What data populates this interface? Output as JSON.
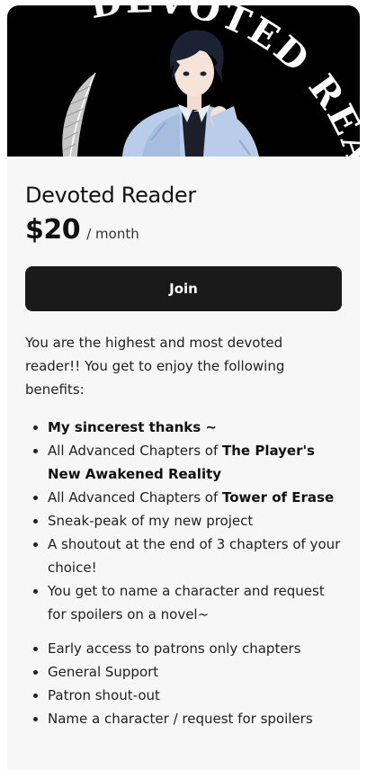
{
  "banner": {
    "arc_text": "DEVOTED READER"
  },
  "tier": {
    "title": "Devoted Reader",
    "price": "$20",
    "period": "/ month",
    "join_label": "Join",
    "description": "You are the highest and most devoted reader!! You get to enjoy the following benefits:"
  },
  "benefits": {
    "b1_bold": "My sincerest thanks ~",
    "b2_pre": "All Advanced Chapters of ",
    "b2_bold": "The Player's New Awakened Reality",
    "b3_pre": "All Advanced Chapters of ",
    "b3_bold": "Tower of Erase",
    "b4": "Sneak-peak of my new project",
    "b5": "A shoutout at the end of 3 chapters of your choice!",
    "b6": "You get to name a character and request for spoilers on a novel~"
  },
  "perks": [
    "Early access to patrons only chapters",
    "General Support",
    "Patron shout-out",
    "Name a character / request for spoilers"
  ],
  "colors": {
    "card_bg": "#f7f7f8",
    "button_bg": "#1a1a1a",
    "banner_bg": "#000000"
  }
}
